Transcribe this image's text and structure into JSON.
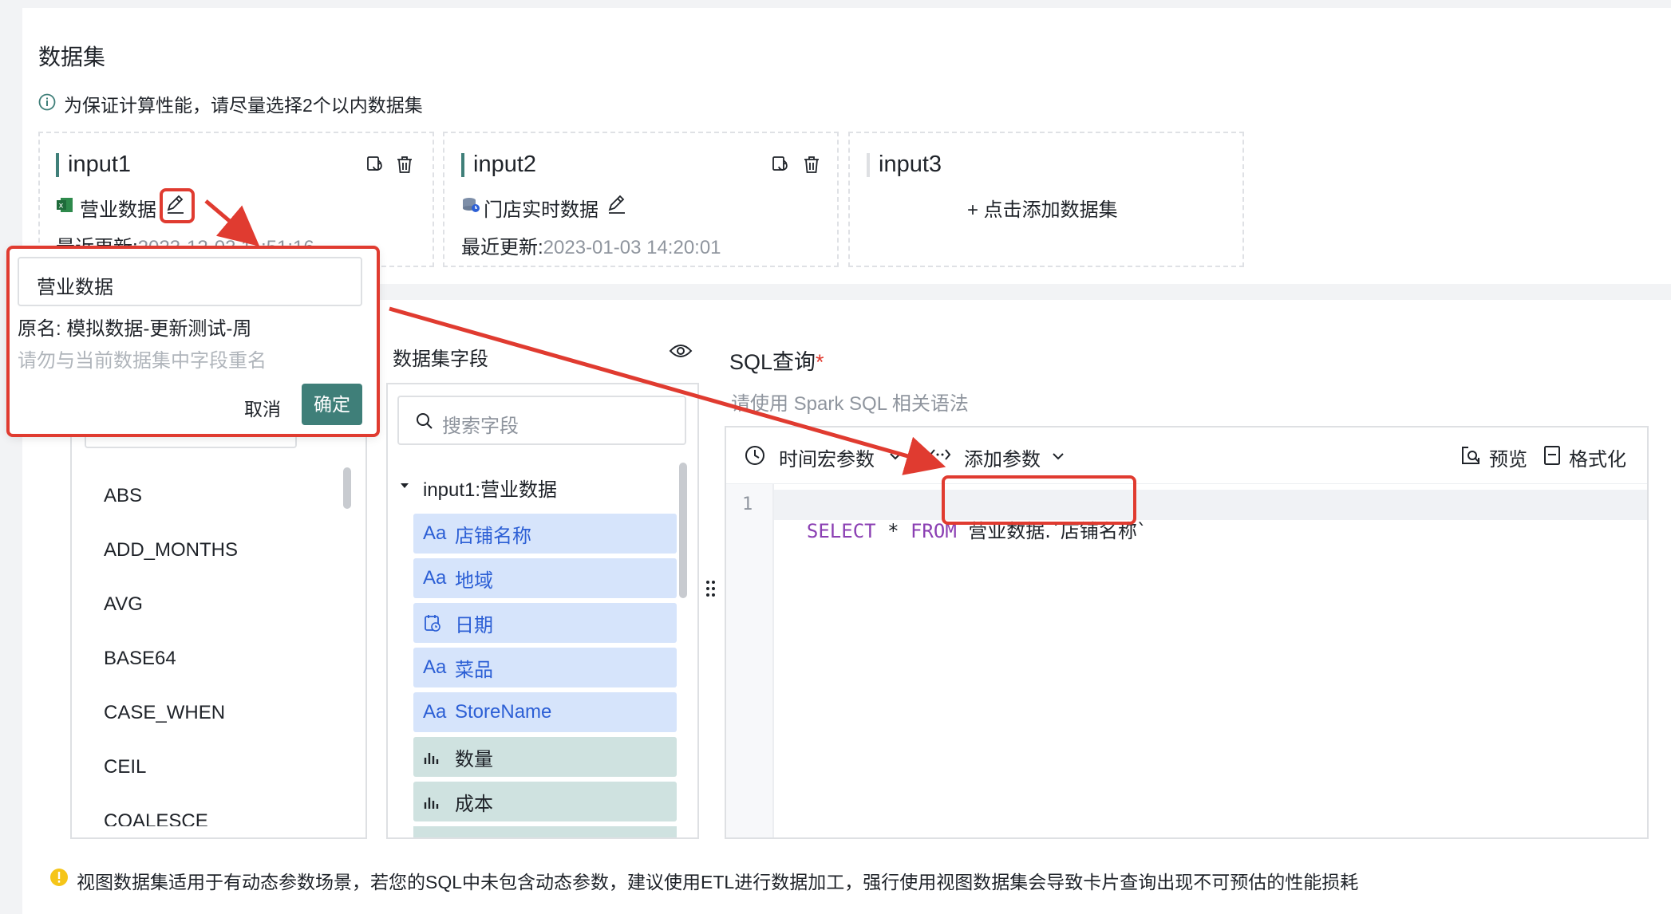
{
  "dataset": {
    "title": "数据集",
    "tip": "为保证计算性能，请尽量选择2个以内数据集",
    "cards": [
      {
        "name": "input1",
        "source": "营业数据",
        "updated_label": "最近更新:",
        "updated_value": "2023-12-03 11:51:16"
      },
      {
        "name": "input2",
        "source": "门店实时数据",
        "updated_label": "最近更新:",
        "updated_value": "2023-01-03 14:20:01"
      },
      {
        "name": "input3",
        "add_label": "+ 点击添加数据集"
      }
    ]
  },
  "rename_popup": {
    "input_value": "营业数据",
    "original_name": "原名: 模拟数据-更新测试-周",
    "hint": "请勿与当前数据集中字段重名",
    "cancel": "取消",
    "confirm": "确定"
  },
  "functions": {
    "items": [
      "ABS",
      "ADD_MONTHS",
      "AVG",
      "BASE64",
      "CASE_WHEN",
      "CEIL",
      "COALESCE"
    ]
  },
  "fields_panel": {
    "title": "数据集字段",
    "search_placeholder": "搜索字段",
    "group": "input1:营业数据",
    "fields": [
      {
        "name": "店铺名称",
        "type": "text",
        "icon": "Aa"
      },
      {
        "name": "地域",
        "type": "text",
        "icon": "Aa"
      },
      {
        "name": "日期",
        "type": "date",
        "icon": "calendar-icon"
      },
      {
        "name": "菜品",
        "type": "text",
        "icon": "Aa"
      },
      {
        "name": "StoreName",
        "type": "text",
        "icon": "Aa"
      },
      {
        "name": "数量",
        "type": "number",
        "icon": "bar-chart-icon"
      },
      {
        "name": "成本",
        "type": "number",
        "icon": "bar-chart-icon"
      }
    ]
  },
  "sql": {
    "title": "SQL查询",
    "required_mark": "*",
    "subtitle": "请使用 Spark SQL 相关语法",
    "toolbar": {
      "time_macro": "时间宏参数",
      "add_param": "添加参数",
      "preview": "预览",
      "format": "格式化"
    },
    "line_number": "1",
    "code_keyword1": "SELECT",
    "code_star": "*",
    "code_keyword2": "FROM",
    "code_ref": "营业数据.`店铺名称`"
  },
  "footer": {
    "warning": "视图数据集适用于有动态参数场景，若您的SQL中未包含动态参数，建议使用ETL进行数据加工，强行使用视图数据集会导致卡片查询出现不可预估的性能损耗"
  },
  "colors": {
    "accent": "#3f7f79",
    "annotation_red": "#e03b30",
    "text_field_bg": "#d6e4fb",
    "number_field_bg": "#cfe2e0",
    "keyword_purple": "#8b3fb3",
    "warning_yellow": "#f5c518"
  }
}
